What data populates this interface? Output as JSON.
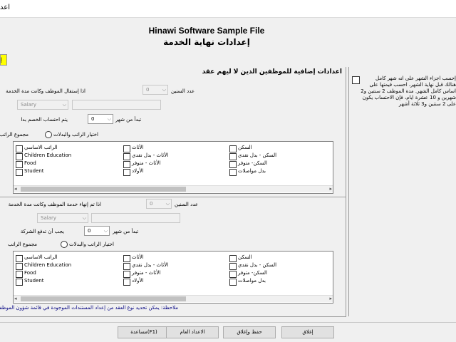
{
  "window": {
    "title": "اعد"
  },
  "header": {
    "title_en": "Hinawi Software Sample File",
    "title_ar": "إعدادات نهاية الخدمة",
    "badge": "إ"
  },
  "section_title": "اعدادات إضافية للموظفين الذين لا ليهم عقد",
  "right_panel": {
    "checkbox_label": "إحسب اجزاء الشهر على انه شهر كامل",
    "description": "هنالك قبل نهاية الشهر، احسب قيمتها على اساس كامل الشهر. مدة الموظف 2 سنتين و2 شهرين و 10 عشرة ايام، فإن الاحتساب يكون على 2 سنتين و3 ثلاثة أشهر"
  },
  "resignation": {
    "condition_label": "اذا إستقال الموظف وكانت مدة الخدمة",
    "years_label": "عدد السنين",
    "years_value": "0",
    "salary_value": "Salary",
    "deduct_label": "يتم احتساب الخصم بدا",
    "months_label": "تبدأ من شهر",
    "months_value": "0",
    "salary_sum_label": "مجموع الراتب",
    "choose_label": "اختيار الراتب والبدلات"
  },
  "termination": {
    "condition_label": "اذا تم إنهاء خدمة الموظف وكانت مدة الخدمة",
    "years_label": "عدد السنين",
    "years_value": "0",
    "salary_value": "Salary",
    "pay_label": "يجب أن تدفع الشركة",
    "months_label": "تبدأ من شهر",
    "months_value": "0",
    "salary_sum_label": "مجموع الراتب",
    "choose_label": "اختيار الراتب والبدلات"
  },
  "items": {
    "col_left": [
      "الراتب الاساسي",
      "Children Education",
      "Food",
      "Student"
    ],
    "col_mid": [
      "الأثاث",
      "الأثاث - بدل نقدي",
      "الأثاث - متوفر",
      "الأولاد"
    ],
    "col_right": [
      "السكن",
      "السكن - بدل نقدي",
      "السكن- متوفر",
      "بدل مواصلات"
    ]
  },
  "note": "ملاحظة: يمكن تحديد نوع العقد من إعداد المستندات الموجودة في قائمة شؤون الموظفين",
  "buttons": {
    "help": "مساعدة(F1)",
    "general_settings": "الاعداد العام",
    "save_close": "حفظ وإغلاق",
    "close": "إغلاق"
  },
  "icons": {
    "dropdown": "chevron-down-icon",
    "scroll_left": "scroll-left-arrow",
    "scroll_right": "scroll-right-arrow"
  }
}
